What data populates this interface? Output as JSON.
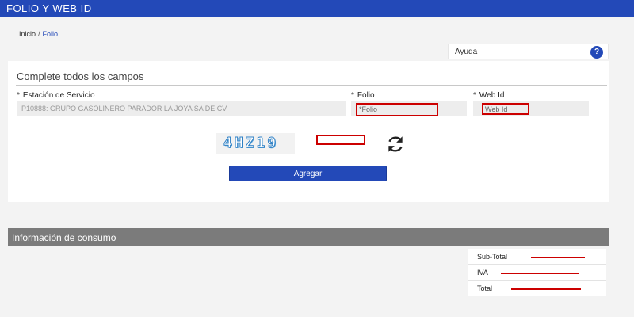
{
  "header": {
    "title": "FOLIO Y WEB ID"
  },
  "breadcrumb": {
    "home": "Inicio",
    "separator": "/",
    "current": "Folio"
  },
  "help": {
    "label": "Ayuda",
    "icon": "?"
  },
  "form": {
    "heading": "Complete todos los campos",
    "required_mark": "*",
    "estacion": {
      "label": "Estación de Servicio",
      "value": "P10888: GRUPO GASOLINERO PARADOR LA JOYA SA DE CV"
    },
    "folio": {
      "label": "Folio",
      "placeholder": "*Folio"
    },
    "webid": {
      "label": "Web Id",
      "placeholder": "Web Id"
    },
    "captcha": {
      "text": "4HZ19"
    },
    "submit_label": "Agregar"
  },
  "consumo": {
    "title": "Información de consumo",
    "rows": [
      {
        "label": "Sub-Total"
      },
      {
        "label": "IVA"
      },
      {
        "label": "Total"
      }
    ]
  },
  "colors": {
    "brand": "#2349b8",
    "section": "#7b7b7b",
    "highlight": "#cc0000"
  }
}
